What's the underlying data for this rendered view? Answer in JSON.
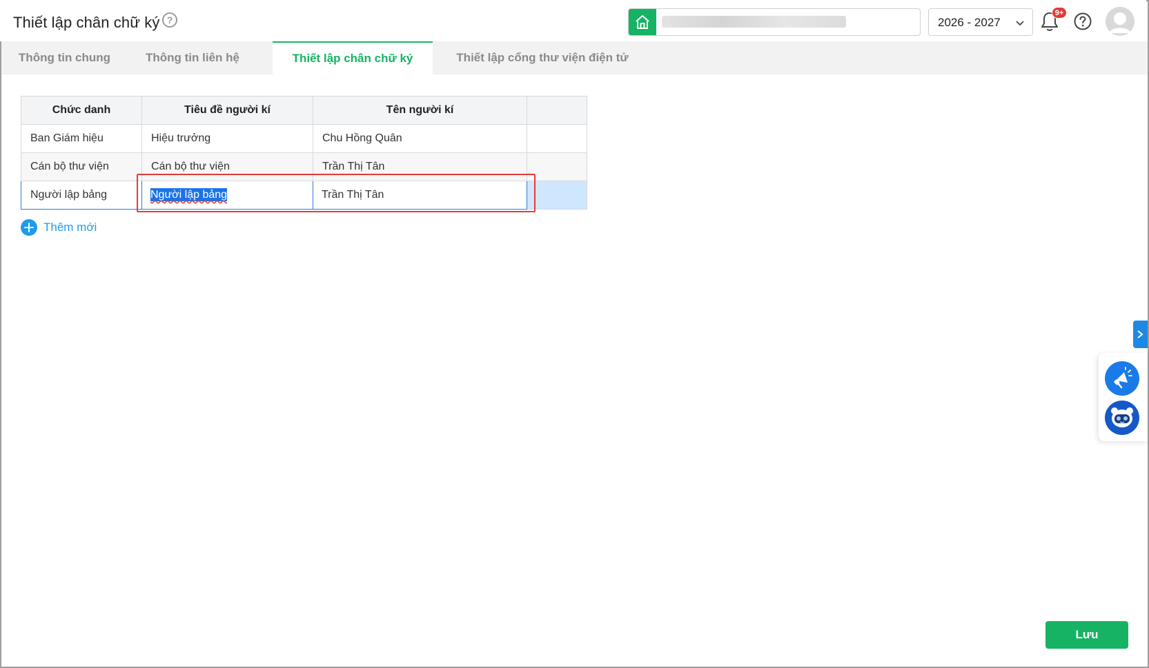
{
  "header": {
    "title": "Thiết lập chân chữ ký",
    "school_value": "",
    "year": "2026 - 2027",
    "notification_badge": "9+"
  },
  "tabs": [
    {
      "label": "Thông tin chung",
      "active": false
    },
    {
      "label": "Thông tin liên hệ",
      "active": false
    },
    {
      "label": "Thiết lập chân chữ ký",
      "active": true
    },
    {
      "label": "Thiết lập cổng thư viện điện tử",
      "active": false
    }
  ],
  "table": {
    "headers": [
      "Chức danh",
      "Tiêu đề người kí",
      "Tên người kí",
      ""
    ],
    "rows": [
      {
        "position": "Ban Giám hiệu",
        "signer_title": "Hiệu trưởng",
        "signer_name": "Chu Hồng Quân"
      },
      {
        "position": "Cán bộ thư viện",
        "signer_title": "Cán bộ thư viện",
        "signer_name": "Trần Thị Tân"
      },
      {
        "position": "Người lập bảng",
        "signer_title": "Người lập bảng",
        "signer_name": "Trần Thị Tân"
      }
    ]
  },
  "add_new_label": "Thêm mới",
  "save_label": "Lưu",
  "colors": {
    "brand_green": "#16b364",
    "link_blue": "#1e9af0",
    "highlight_red": "#e53935"
  },
  "icons": [
    "home-icon",
    "chevron-down-icon",
    "bell-icon",
    "help-icon",
    "avatar",
    "chevron-right-icon",
    "megaphone-icon",
    "robot-icon"
  ]
}
